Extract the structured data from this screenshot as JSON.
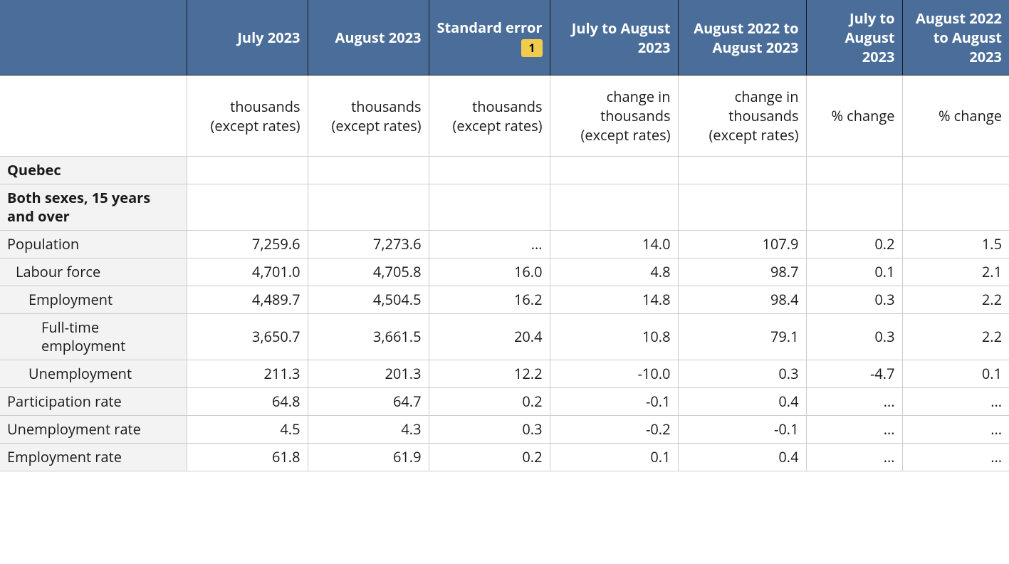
{
  "chart_data": {
    "type": "table",
    "columns": [
      {
        "label": "July 2023",
        "units": "thousands (except rates)"
      },
      {
        "label": "August 2023",
        "units": "thousands (except rates)"
      },
      {
        "label": "Standard error",
        "footnote": "1",
        "units": "thousands (except rates)"
      },
      {
        "label": "July to August 2023",
        "units": "change in thousands (except rates)"
      },
      {
        "label": "August 2022 to August 2023",
        "units": "change in thousands (except rates)"
      },
      {
        "label": "July to August 2023",
        "units": "% change"
      },
      {
        "label": "August 2022 to August 2023",
        "units": "% change"
      }
    ],
    "section1": "Quebec",
    "section2": "Both sexes, 15 years and over",
    "rows": [
      {
        "label": "Population",
        "indent": 0,
        "vals": [
          "7,259.6",
          "7,273.6",
          "...",
          "14.0",
          "107.9",
          "0.2",
          "1.5"
        ]
      },
      {
        "label": "Labour force",
        "indent": 1,
        "vals": [
          "4,701.0",
          "4,705.8",
          "16.0",
          "4.8",
          "98.7",
          "0.1",
          "2.1"
        ]
      },
      {
        "label": "Employment",
        "indent": 2,
        "vals": [
          "4,489.7",
          "4,504.5",
          "16.2",
          "14.8",
          "98.4",
          "0.3",
          "2.2"
        ]
      },
      {
        "label": "Full-time employment",
        "indent": 3,
        "vals": [
          "3,650.7",
          "3,661.5",
          "20.4",
          "10.8",
          "79.1",
          "0.3",
          "2.2"
        ]
      },
      {
        "label": "Unemployment",
        "indent": 2,
        "vals": [
          "211.3",
          "201.3",
          "12.2",
          "-10.0",
          "0.3",
          "-4.7",
          "0.1"
        ]
      },
      {
        "label": "Participation rate",
        "indent": 0,
        "vals": [
          "64.8",
          "64.7",
          "0.2",
          "-0.1",
          "0.4",
          "...",
          "..."
        ]
      },
      {
        "label": "Unemployment rate",
        "indent": 0,
        "vals": [
          "4.5",
          "4.3",
          "0.3",
          "-0.2",
          "-0.1",
          "...",
          "..."
        ]
      },
      {
        "label": "Employment rate",
        "indent": 0,
        "vals": [
          "61.8",
          "61.9",
          "0.2",
          "0.1",
          "0.4",
          "...",
          "..."
        ]
      }
    ]
  }
}
